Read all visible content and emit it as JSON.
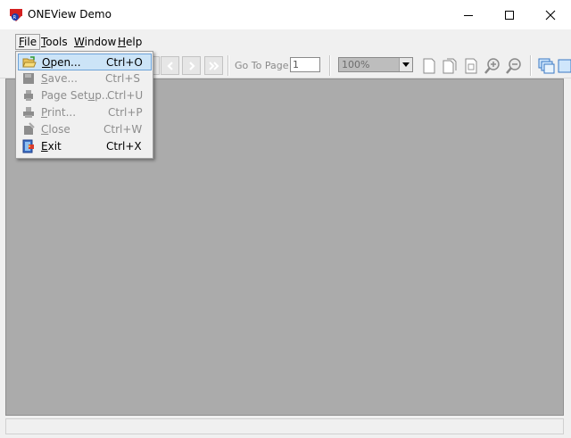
{
  "window": {
    "title": "ONEView Demo",
    "app_icon": "oneview-app-icon"
  },
  "menubar": {
    "items": [
      {
        "label": "File",
        "mnemonic": "F",
        "rest": "ile"
      },
      {
        "label": "Tools",
        "mnemonic": "T",
        "rest": "ools"
      },
      {
        "label": "Window",
        "mnemonic": "W",
        "rest": "indow"
      },
      {
        "label": "Help",
        "mnemonic": "H",
        "rest": "elp"
      }
    ]
  },
  "file_menu": {
    "items": [
      {
        "label_u": "O",
        "label_rest": "pen...",
        "shortcut": "Ctrl+O",
        "enabled": true,
        "highlighted": true,
        "icon": "open-folder-icon"
      },
      {
        "label_u": "S",
        "label_rest": "ave...",
        "shortcut": "Ctrl+S",
        "enabled": false,
        "icon": "save-icon"
      },
      {
        "label_pre": "Page Set",
        "label_u": "u",
        "label_rest": "p...",
        "shortcut": "Ctrl+U",
        "enabled": false,
        "icon": "page-setup-icon"
      },
      {
        "label_u": "P",
        "label_rest": "rint...",
        "shortcut": "Ctrl+P",
        "enabled": false,
        "icon": "print-icon"
      },
      {
        "label_u": "C",
        "label_rest": "lose",
        "shortcut": "Ctrl+W",
        "enabled": false,
        "icon": "close-doc-icon"
      },
      {
        "label_u": "E",
        "label_rest": "xit",
        "shortcut": "Ctrl+X",
        "enabled": true,
        "icon": "exit-icon"
      }
    ]
  },
  "toolbar": {
    "goto_label": "Go To Page",
    "goto_value": "1",
    "zoom_value": "100%"
  },
  "colors": {
    "client_bg": "#ababab",
    "menu_highlight": "#cce4f7",
    "menu_highlight_border": "#6da3d9",
    "disabled_text": "#8d8d8d"
  }
}
